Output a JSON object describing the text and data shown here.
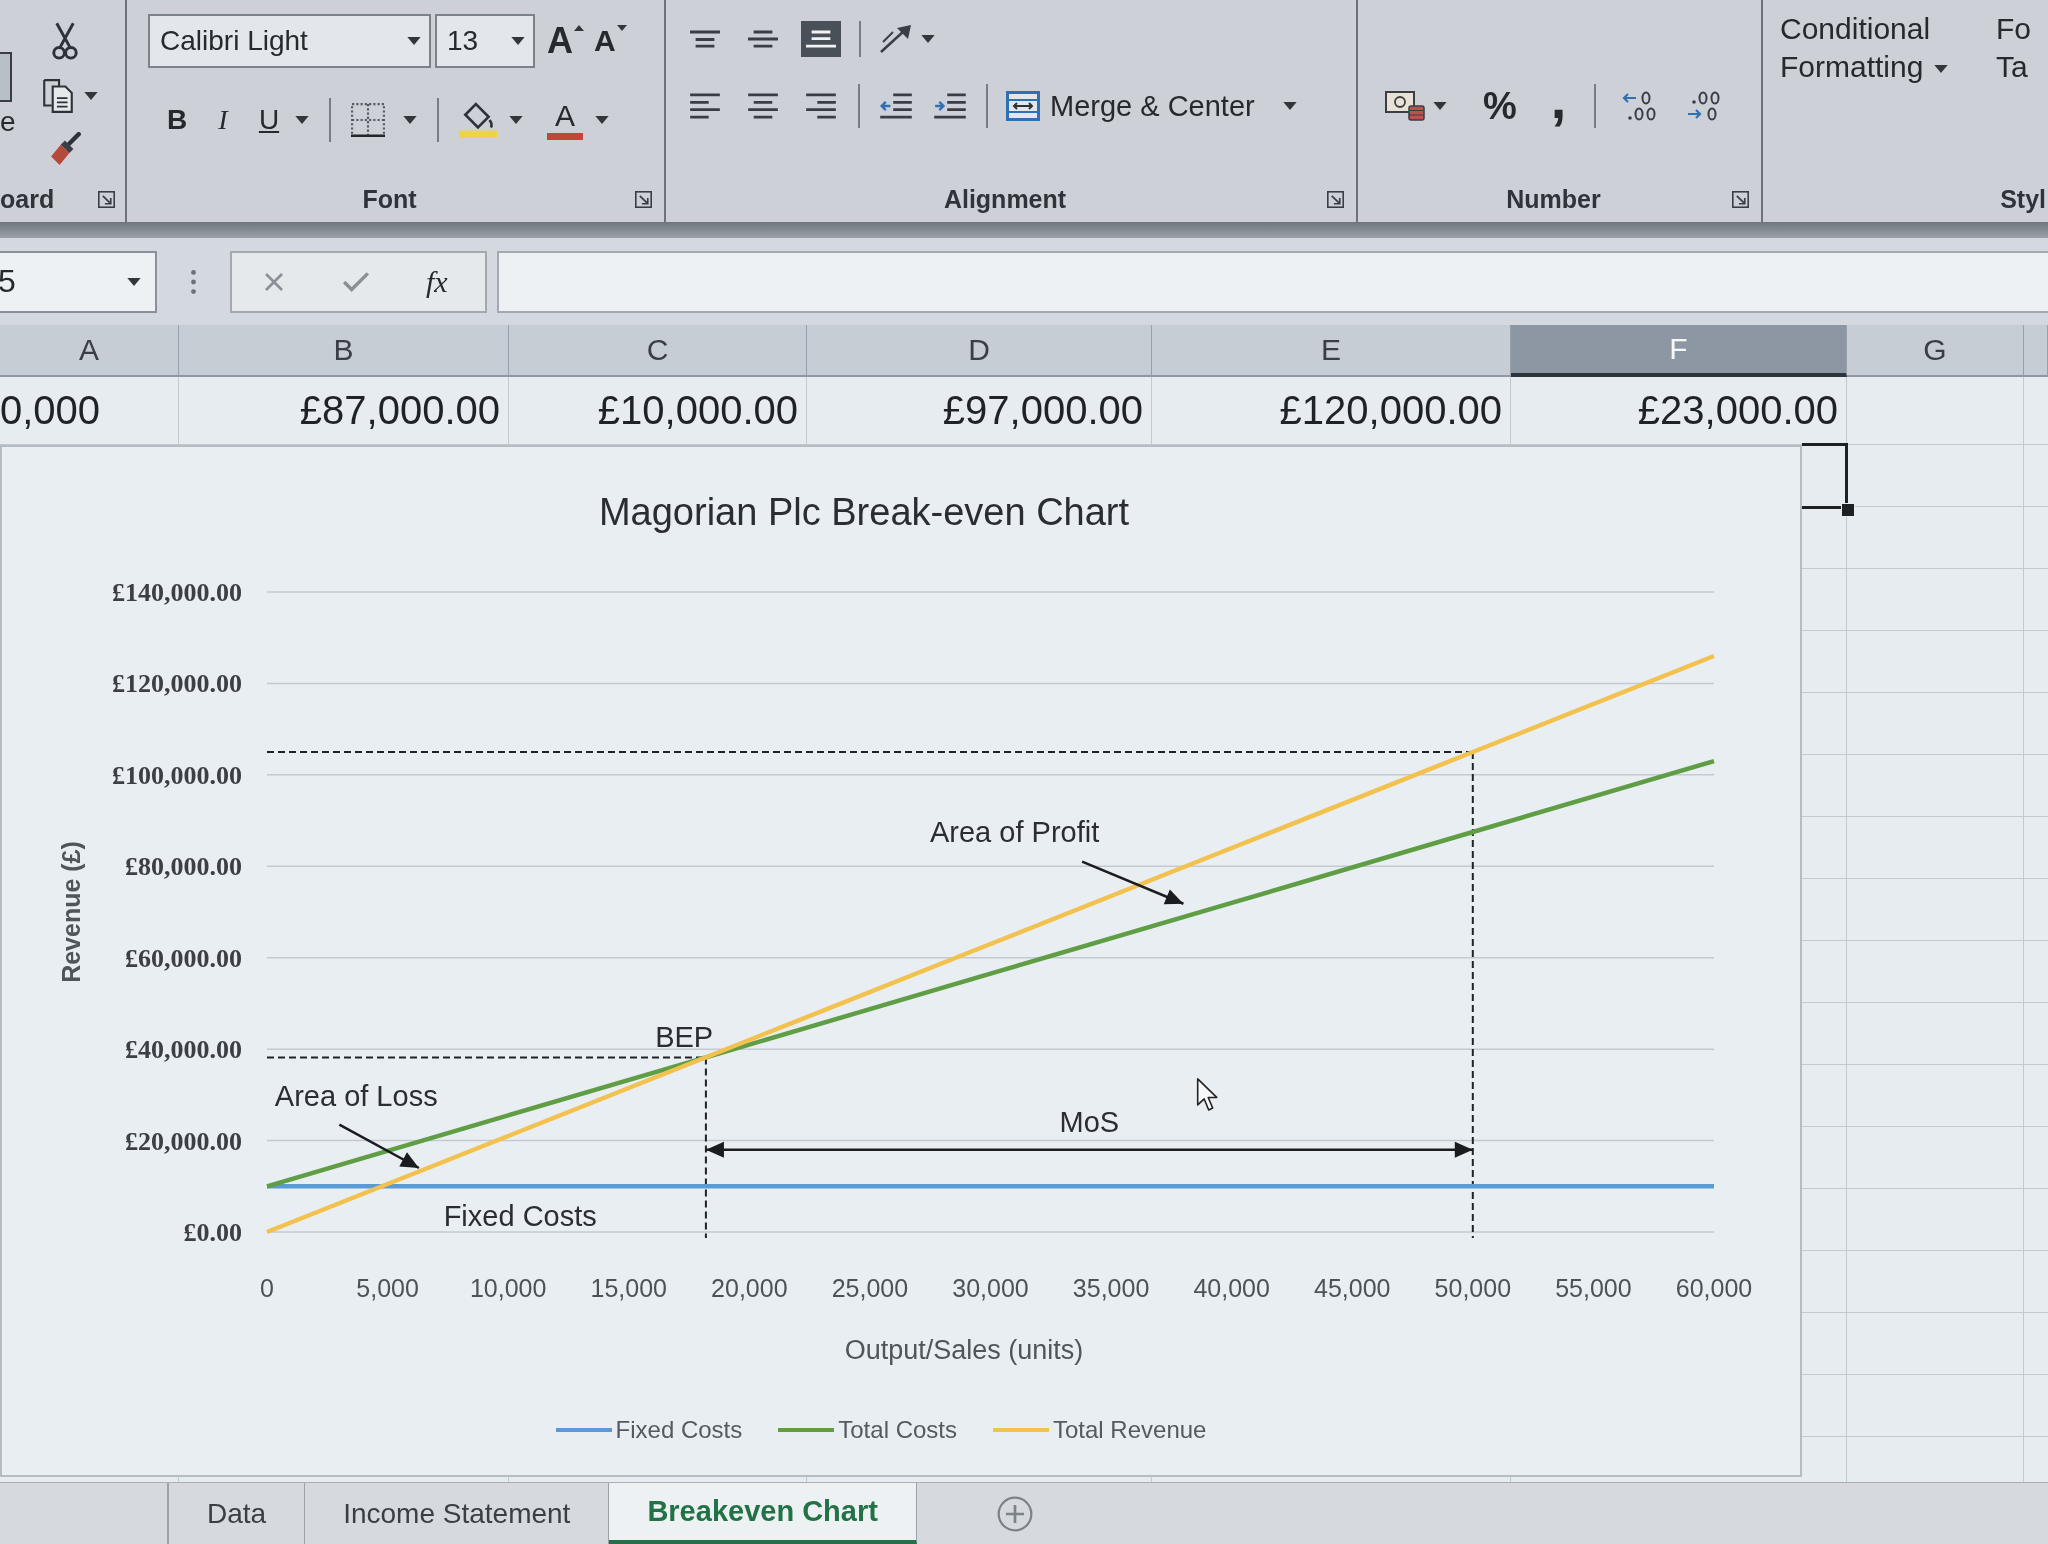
{
  "ribbon": {
    "clipboard": {
      "paste_label": "e",
      "group_label": "oard"
    },
    "font": {
      "font_name": "Calibri Light",
      "font_size": "13",
      "grow_button": "A",
      "shrink_button": "A",
      "bold_button": "B",
      "italic_button": "I",
      "underline_button": "U",
      "font_color_button": "A",
      "group_label": "Font"
    },
    "alignment": {
      "vertical_buttons": [
        {
          "kind": "top",
          "on": false
        },
        {
          "kind": "middle",
          "on": false
        },
        {
          "kind": "bottom",
          "on": true
        }
      ],
      "horizontal_buttons": [
        {
          "kind": "left"
        },
        {
          "kind": "center"
        },
        {
          "kind": "right"
        }
      ],
      "merge_button": "Merge & Center",
      "group_label": "Alignment"
    },
    "number": {
      "percent_button": "%",
      "comma_button": ",",
      "group_label": "Number"
    },
    "styles": {
      "conditional_formatting_button": "Conditional Formatting",
      "format_as_table_lines": [
        "Fo",
        "Ta"
      ],
      "group_label": "Styl"
    }
  },
  "formula_bar": {
    "name_box": "5",
    "function_button": "fx"
  },
  "sheet": {
    "columns": [
      {
        "label": "A",
        "selected": false
      },
      {
        "label": "B",
        "selected": false
      },
      {
        "label": "C",
        "selected": false
      },
      {
        "label": "D",
        "selected": false
      },
      {
        "label": "E",
        "selected": false
      },
      {
        "label": "F",
        "selected": true
      },
      {
        "label": "G",
        "selected": false
      }
    ],
    "row_values": [
      "0,000",
      "£87,000.00",
      "£10,000.00",
      "£97,000.00",
      "£120,000.00",
      "£23,000.00"
    ]
  },
  "chart": {
    "chart_data": {
      "type": "line",
      "title": "Magorian Plc Break-even Chart",
      "xlabel": "Output/Sales (units)",
      "ylabel": "Revenue (£)",
      "x": [
        0,
        10000,
        20000,
        30000,
        40000,
        50000,
        60000
      ],
      "series": [
        {
          "name": "Fixed Costs",
          "color": "#5b9bd5",
          "values": [
            10000,
            10000,
            10000,
            10000,
            10000,
            10000,
            10000
          ]
        },
        {
          "name": "Total Costs",
          "color": "#5f9e45",
          "values": [
            10000,
            25500,
            41000,
            56500,
            72000,
            87500,
            103000
          ]
        },
        {
          "name": "Total Revenue",
          "color": "#f2c14e",
          "values": [
            0,
            21000,
            42000,
            63000,
            84000,
            105000,
            126000
          ]
        }
      ],
      "xlim": [
        0,
        60000
      ],
      "ylim": [
        0,
        140000
      ],
      "xticks": [
        {
          "value": 0,
          "label": "0"
        },
        {
          "value": 5000,
          "label": "5,000"
        },
        {
          "value": 10000,
          "label": "10,000"
        },
        {
          "value": 15000,
          "label": "15,000"
        },
        {
          "value": 20000,
          "label": "20,000"
        },
        {
          "value": 25000,
          "label": "25,000"
        },
        {
          "value": 30000,
          "label": "30,000"
        },
        {
          "value": 35000,
          "label": "35,000"
        },
        {
          "value": 40000,
          "label": "40,000"
        },
        {
          "value": 45000,
          "label": "45,000"
        },
        {
          "value": 50000,
          "label": "50,000"
        },
        {
          "value": 55000,
          "label": "55,000"
        },
        {
          "value": 60000,
          "label": "60,000"
        }
      ],
      "yticks": [
        {
          "value": 0,
          "label": "£0.00"
        },
        {
          "value": 20000,
          "label": "£20,000.00"
        },
        {
          "value": 40000,
          "label": "£40,000.00"
        },
        {
          "value": 60000,
          "label": "£60,000.00"
        },
        {
          "value": 80000,
          "label": "£80,000.00"
        },
        {
          "value": 100000,
          "label": "£100,000.00"
        },
        {
          "value": 120000,
          "label": "£120,000.00"
        },
        {
          "value": 140000,
          "label": "£140,000.00"
        }
      ],
      "grid": true,
      "legend": "bottom",
      "ref_lines": [
        {
          "axis": "x",
          "value": 18200
        },
        {
          "axis": "y",
          "value": 38200
        },
        {
          "axis": "x",
          "value": 50000
        },
        {
          "axis": "y",
          "value": 105000
        }
      ],
      "annotations": [
        "BEP",
        "Area of Profit",
        "Area of Loss",
        "MoS",
        "Fixed Costs"
      ]
    }
  },
  "sheet_tabs": [
    {
      "label": "Data",
      "selected": false
    },
    {
      "label": "Income Statement",
      "selected": false
    },
    {
      "label": "Breakeven Chart",
      "selected": true
    }
  ]
}
